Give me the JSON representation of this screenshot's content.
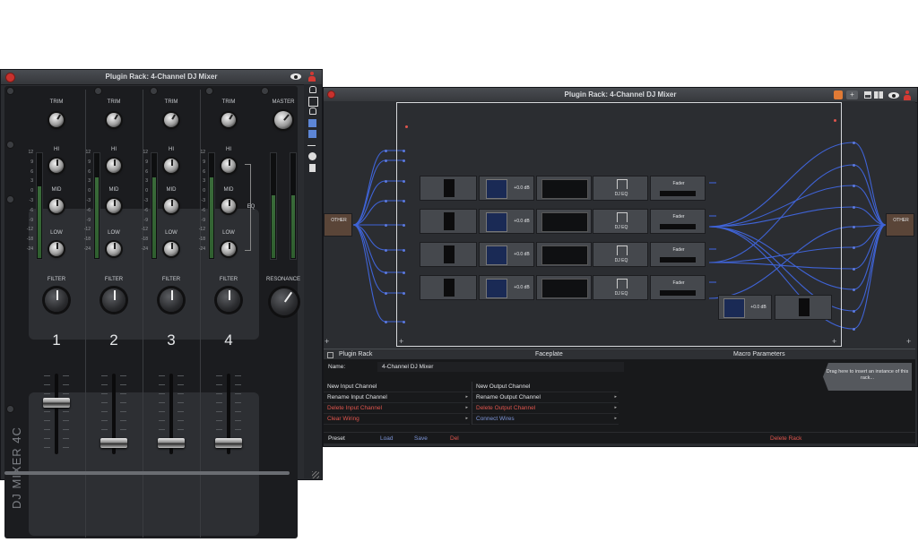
{
  "mixer_window": {
    "title": "Plugin Rack: 4-Channel DJ Mixer",
    "brand": "DJ MIXER 4C",
    "channels": [
      {
        "trim": "TRIM",
        "hi": "HI",
        "mid": "MID",
        "low": "LOW",
        "filter": "FILTER",
        "number": "1",
        "fader_level": 0.65
      },
      {
        "trim": "TRIM",
        "hi": "HI",
        "mid": "MID",
        "low": "LOW",
        "filter": "FILTER",
        "number": "2",
        "fader_level": 0.0
      },
      {
        "trim": "TRIM",
        "hi": "HI",
        "mid": "MID",
        "low": "LOW",
        "filter": "FILTER",
        "number": "3",
        "fader_level": 0.0
      },
      {
        "trim": "TRIM",
        "hi": "HI",
        "mid": "MID",
        "low": "LOW",
        "filter": "FILTER",
        "number": "4",
        "fader_level": 0.0
      }
    ],
    "master_label": "MASTER",
    "resonance_label": "RESONANCE",
    "eq_label": "EQ",
    "meter_scale": [
      "12",
      "9",
      "6",
      "3",
      "0",
      "-3",
      "-6",
      "-9",
      "-12",
      "-18",
      "-24"
    ]
  },
  "rack_window": {
    "title": "Plugin Rack: 4-Channel DJ Mixer",
    "input_node": "OTHER",
    "output_node": "OTHER",
    "rows": [
      {
        "gain": "+0.0 dB",
        "eq": "DJ EQ",
        "fader": "Fader"
      },
      {
        "gain": "+0.0 dB",
        "eq": "DJ EQ",
        "fader": "Fader"
      },
      {
        "gain": "+0.0 dB",
        "eq": "DJ EQ",
        "fader": "Fader"
      },
      {
        "gain": "+0.0 dB",
        "eq": "DJ EQ",
        "fader": "Fader"
      }
    ],
    "master_gain": "+0.0 dB",
    "tabs": [
      "Plugin Rack",
      "Faceplate",
      "Macro Parameters"
    ],
    "name_label": "Name:",
    "name_value": "4-Channel DJ Mixer",
    "input_menu": [
      {
        "label": "New Input Channel",
        "style": "white",
        "arrow": ""
      },
      {
        "label": "Rename Input Channel",
        "style": "white",
        "arrow": "▸"
      },
      {
        "label": "Delete Input Channel",
        "style": "red",
        "arrow": "▸"
      },
      {
        "label": "Clear Wiring",
        "style": "red",
        "arrow": "▸"
      }
    ],
    "output_menu": [
      {
        "label": "New Output Channel",
        "style": "white",
        "arrow": ""
      },
      {
        "label": "Rename Output Channel",
        "style": "white",
        "arrow": "▸"
      },
      {
        "label": "Delete Output Channel",
        "style": "red",
        "arrow": "▸"
      },
      {
        "label": "Connect Wires",
        "style": "blue",
        "arrow": "▸"
      }
    ],
    "drag_hint": "Drag here to insert an instance of this rack...",
    "preset_label": "Preset",
    "load": "Load",
    "save": "Save",
    "del": "Del",
    "delete_rack": "Delete Rack"
  },
  "colors": {
    "accent_red": "#e0554d",
    "link_blue": "#7d95d8",
    "wire_blue": "#3f63d6",
    "window_bg": "#2a2c30"
  }
}
